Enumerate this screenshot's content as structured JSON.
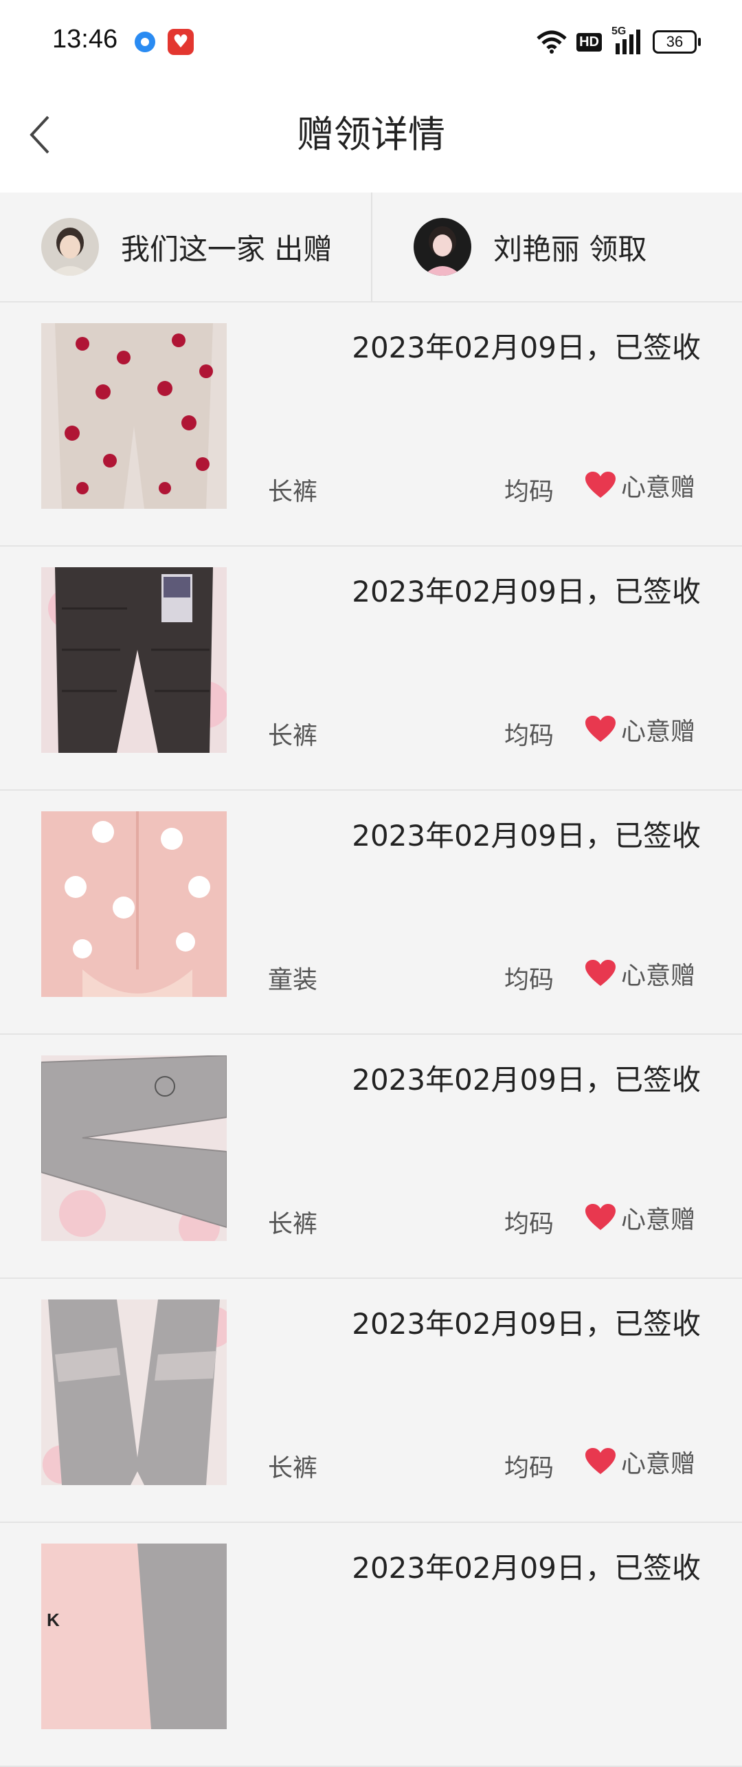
{
  "status_bar": {
    "time": "13:46",
    "hd_label": "HD",
    "network_label": "5G",
    "battery_level": "36"
  },
  "header": {
    "title": "赠领详情",
    "back_icon": "chevron-left-icon"
  },
  "users": {
    "giver": {
      "name": "我们这一家 出赠"
    },
    "receiver": {
      "name": "刘艳丽 领取"
    }
  },
  "gifts": [
    {
      "date_status": "2023年02月09日，已签收",
      "category": "长裤",
      "size": "均码",
      "gift_type": "心意赠",
      "image": "pink-pants-strawberry"
    },
    {
      "date_status": "2023年02月09日，已签收",
      "category": "长裤",
      "size": "均码",
      "gift_type": "心意赠",
      "image": "dark-quilted-pants"
    },
    {
      "date_status": "2023年02月09日，已签收",
      "category": "童装",
      "size": "均码",
      "gift_type": "心意赠",
      "image": "pink-bodysuit-cartoon"
    },
    {
      "date_status": "2023年02月09日，已签收",
      "category": "长裤",
      "size": "均码",
      "gift_type": "心意赠",
      "image": "grey-leggings-cat"
    },
    {
      "date_status": "2023年02月09日，已签收",
      "category": "长裤",
      "size": "均码",
      "gift_type": "心意赠",
      "image": "grey-leggings-lace"
    },
    {
      "date_status": "2023年02月09日，已签收",
      "category": "",
      "size": "",
      "gift_type": "",
      "image": "pink-shirt-grey-pants"
    }
  ],
  "colors": {
    "heart": "#e8384f",
    "background": "#f4f4f4"
  }
}
